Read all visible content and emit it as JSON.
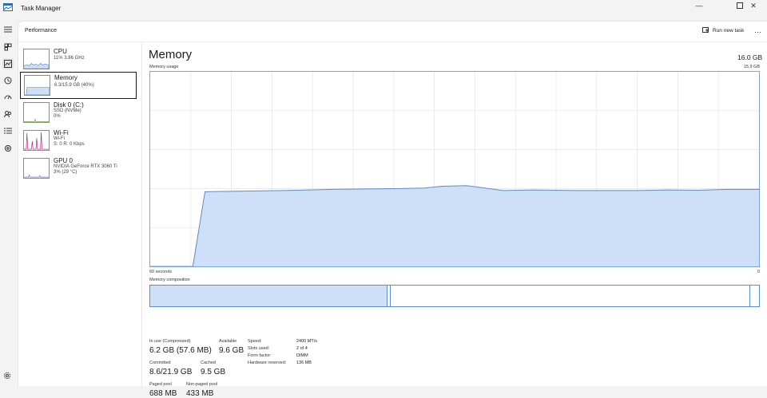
{
  "window": {
    "title": "Task Manager"
  },
  "header": {
    "title": "Performance",
    "run_task": "Run new task",
    "more": "…"
  },
  "perf_items": [
    {
      "name": "CPU",
      "sub1": "11%  3.86 GHz",
      "sub2": "",
      "sub3": ""
    },
    {
      "name": "Memory",
      "sub1": "6.3/15.9 GB (40%)",
      "sub2": "",
      "sub3": ""
    },
    {
      "name": "Disk 0 (C:)",
      "sub1": "SSD (NVMe)",
      "sub2": "0%",
      "sub3": ""
    },
    {
      "name": "Wi-Fi",
      "sub1": "Wi-Fi",
      "sub2": "S: 0 R: 0 Kbps",
      "sub3": ""
    },
    {
      "name": "GPU 0",
      "sub1": "NVIDIA GeForce RTX 3060 Ti",
      "sub2": "3% (29 °C)",
      "sub3": ""
    }
  ],
  "memory": {
    "title": "Memory",
    "total": "16.0 GB",
    "usage_label": "Memory usage",
    "usage_max": "15.9 GB",
    "axis_left": "60 seconds",
    "axis_right": "0",
    "composition_label": "Memory composition",
    "composition_in_use_fraction": 0.39,
    "composition_modified_fraction": 0.005,
    "composition_standby_fraction": 0.59,
    "stats": {
      "in_use_label": "In use (Compressed)",
      "in_use": "6.2 GB (57.6 MB)",
      "available_label": "Available",
      "available": "9.6 GB",
      "committed_label": "Committed",
      "committed": "8.6/21.9 GB",
      "cached_label": "Cached",
      "cached": "9.5 GB",
      "paged_label": "Paged pool",
      "paged": "688 MB",
      "nonpaged_label": "Non-paged pool",
      "nonpaged": "433 MB"
    },
    "details": {
      "speed_label": "Speed:",
      "speed": "2400 MT/s",
      "slots_label": "Slots used:",
      "slots": "2 of 4",
      "form_label": "Form factor:",
      "form": "DIMM",
      "reserved_label": "Hardware reserved:",
      "reserved": "136 MB"
    }
  },
  "colors": {
    "accent": "#4a86d4",
    "fill": "#cde0f7",
    "line": "#5b8ccc",
    "grid": "#e3e3e3"
  },
  "chart_data": {
    "type": "area",
    "ylabel": "Memory usage",
    "ylim": [
      0,
      15.9
    ],
    "x": [
      0,
      7,
      9,
      15,
      22,
      30,
      40,
      45,
      48,
      52,
      58,
      63,
      70,
      80,
      85,
      90,
      95,
      100
    ],
    "values": [
      0,
      0,
      6.1,
      6.15,
      6.2,
      6.3,
      6.35,
      6.4,
      6.55,
      6.6,
      6.2,
      6.25,
      6.2,
      6.2,
      6.25,
      6.22,
      6.3,
      6.3
    ]
  }
}
